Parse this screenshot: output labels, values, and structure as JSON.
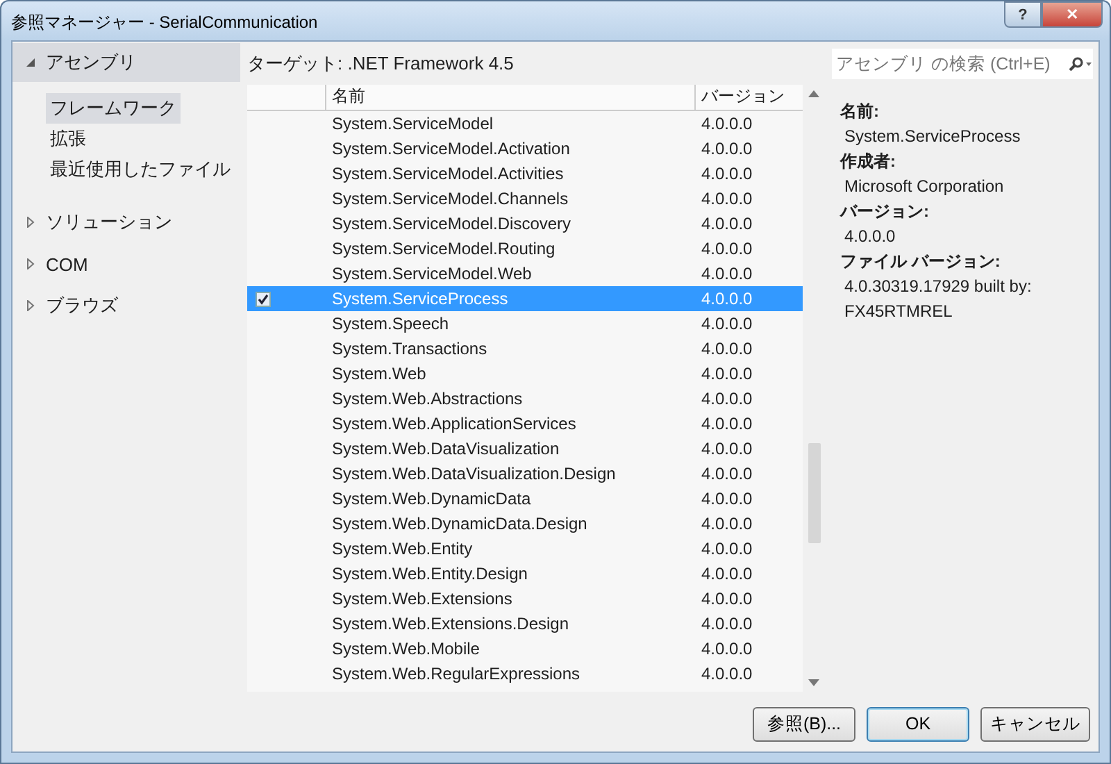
{
  "window": {
    "title": "参照マネージャー - SerialCommunication",
    "help": "?",
    "close": "✕"
  },
  "nav": [
    {
      "label": "アセンブリ",
      "expanded": true,
      "children": [
        {
          "label": "フレームワーク",
          "selected": true
        },
        {
          "label": "拡張",
          "selected": false
        },
        {
          "label": "最近使用したファイル",
          "selected": false
        }
      ]
    },
    {
      "label": "ソリューション",
      "expanded": false
    },
    {
      "label": "COM",
      "expanded": false
    },
    {
      "label": "ブラウズ",
      "expanded": false
    }
  ],
  "target": "ターゲット: .NET Framework 4.5",
  "search": {
    "placeholder": "アセンブリ の検索 (Ctrl+E)"
  },
  "table": {
    "columns": [
      "名前",
      "バージョン"
    ],
    "rows": [
      {
        "name": "System.ServiceModel",
        "version": "4.0.0.0",
        "checked": false,
        "selected": false
      },
      {
        "name": "System.ServiceModel.Activation",
        "version": "4.0.0.0",
        "checked": false,
        "selected": false
      },
      {
        "name": "System.ServiceModel.Activities",
        "version": "4.0.0.0",
        "checked": false,
        "selected": false
      },
      {
        "name": "System.ServiceModel.Channels",
        "version": "4.0.0.0",
        "checked": false,
        "selected": false
      },
      {
        "name": "System.ServiceModel.Discovery",
        "version": "4.0.0.0",
        "checked": false,
        "selected": false
      },
      {
        "name": "System.ServiceModel.Routing",
        "version": "4.0.0.0",
        "checked": false,
        "selected": false
      },
      {
        "name": "System.ServiceModel.Web",
        "version": "4.0.0.0",
        "checked": false,
        "selected": false
      },
      {
        "name": "System.ServiceProcess",
        "version": "4.0.0.0",
        "checked": true,
        "selected": true
      },
      {
        "name": "System.Speech",
        "version": "4.0.0.0",
        "checked": false,
        "selected": false
      },
      {
        "name": "System.Transactions",
        "version": "4.0.0.0",
        "checked": false,
        "selected": false
      },
      {
        "name": "System.Web",
        "version": "4.0.0.0",
        "checked": false,
        "selected": false
      },
      {
        "name": "System.Web.Abstractions",
        "version": "4.0.0.0",
        "checked": false,
        "selected": false
      },
      {
        "name": "System.Web.ApplicationServices",
        "version": "4.0.0.0",
        "checked": false,
        "selected": false
      },
      {
        "name": "System.Web.DataVisualization",
        "version": "4.0.0.0",
        "checked": false,
        "selected": false
      },
      {
        "name": "System.Web.DataVisualization.Design",
        "version": "4.0.0.0",
        "checked": false,
        "selected": false
      },
      {
        "name": "System.Web.DynamicData",
        "version": "4.0.0.0",
        "checked": false,
        "selected": false
      },
      {
        "name": "System.Web.DynamicData.Design",
        "version": "4.0.0.0",
        "checked": false,
        "selected": false
      },
      {
        "name": "System.Web.Entity",
        "version": "4.0.0.0",
        "checked": false,
        "selected": false
      },
      {
        "name": "System.Web.Entity.Design",
        "version": "4.0.0.0",
        "checked": false,
        "selected": false
      },
      {
        "name": "System.Web.Extensions",
        "version": "4.0.0.0",
        "checked": false,
        "selected": false
      },
      {
        "name": "System.Web.Extensions.Design",
        "version": "4.0.0.0",
        "checked": false,
        "selected": false
      },
      {
        "name": "System.Web.Mobile",
        "version": "4.0.0.0",
        "checked": false,
        "selected": false
      },
      {
        "name": "System.Web.RegularExpressions",
        "version": "4.0.0.0",
        "checked": false,
        "selected": false
      }
    ]
  },
  "details": [
    {
      "label": "名前:",
      "value": "System.ServiceProcess"
    },
    {
      "label": "作成者:",
      "value": "Microsoft Corporation"
    },
    {
      "label": "バージョン:",
      "value": "4.0.0.0"
    },
    {
      "label": "ファイル バージョン:",
      "value": "4.0.30319.17929 built by: FX45RTMREL"
    }
  ],
  "buttons": [
    {
      "label": "参照(B)...",
      "default": false
    },
    {
      "label": "OK",
      "default": true
    },
    {
      "label": "キャンセル",
      "default": false
    }
  ]
}
